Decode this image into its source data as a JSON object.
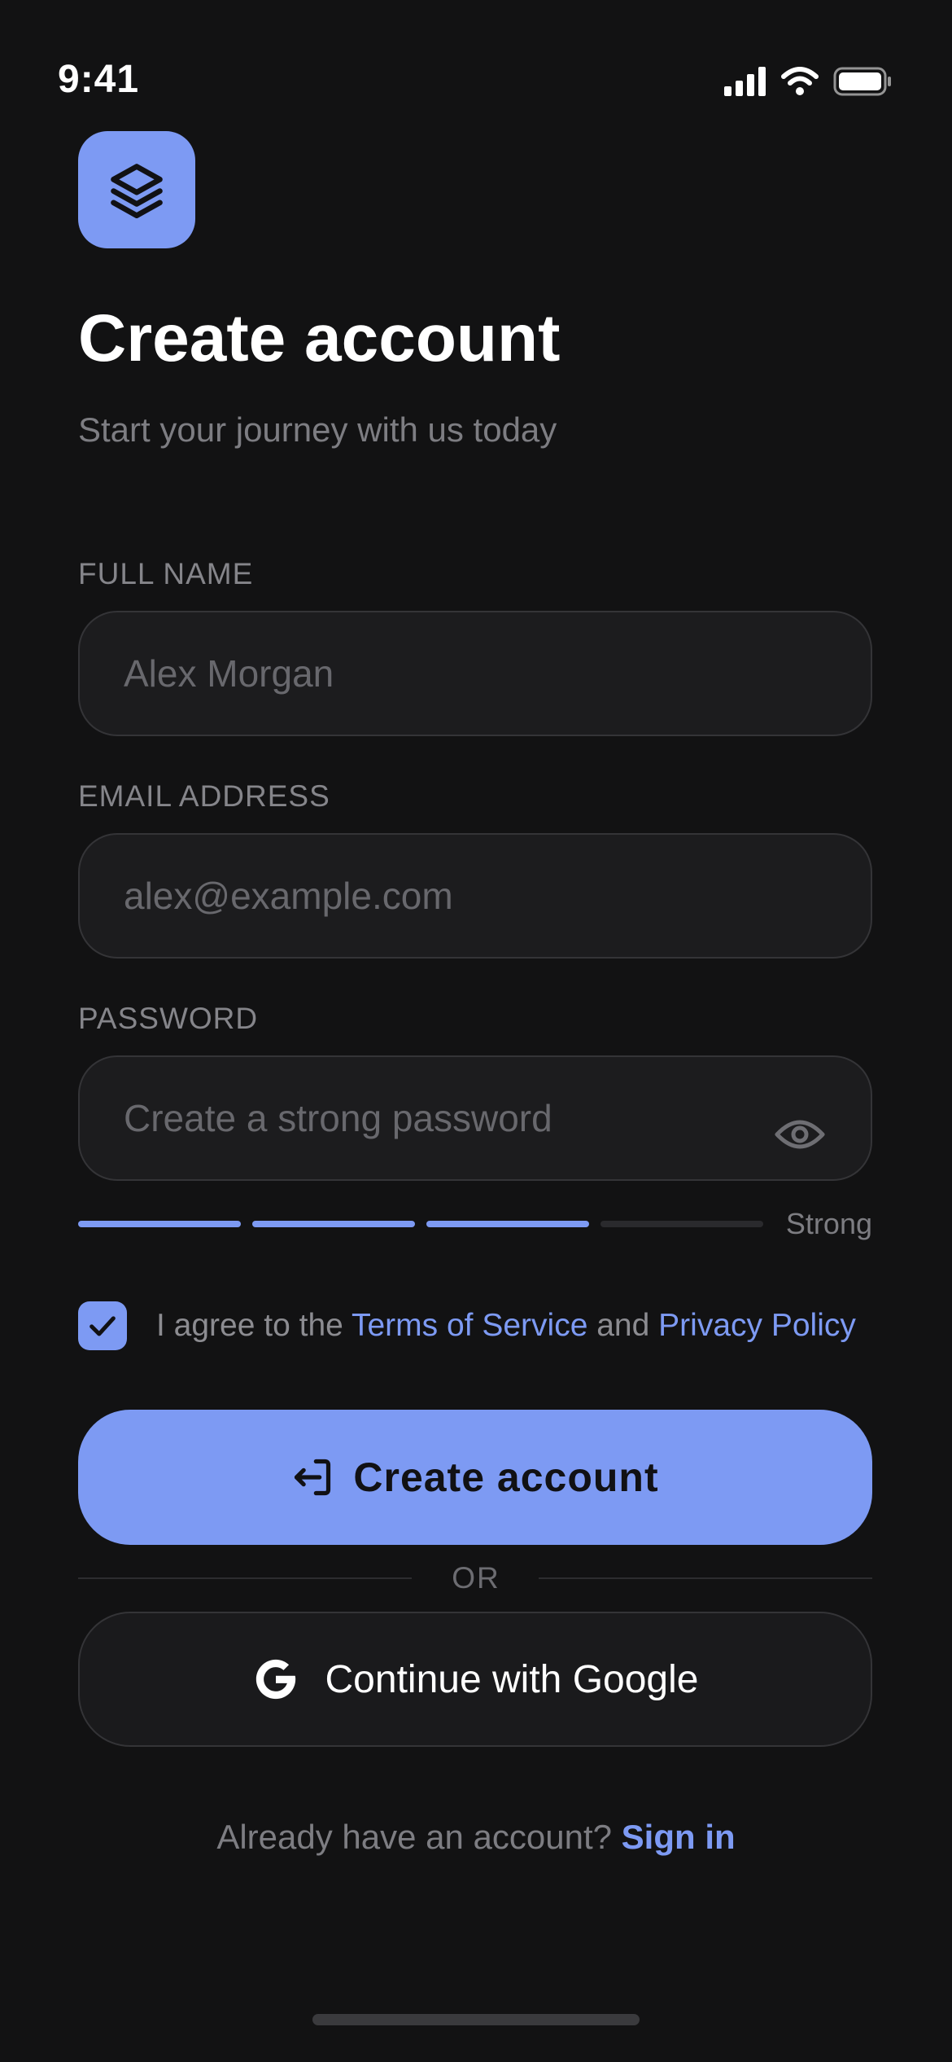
{
  "status_bar": {
    "time": "9:41",
    "icons": [
      "cellular-signal-icon",
      "wifi-icon",
      "battery-icon"
    ]
  },
  "header": {
    "logo_icon": "layers-stack-icon",
    "title": "Create account",
    "subtitle": "Start your journey with us today"
  },
  "form": {
    "full_name": {
      "label": "FULL NAME",
      "placeholder": "Alex Morgan",
      "value": ""
    },
    "email": {
      "label": "EMAIL ADDRESS",
      "placeholder": "alex@example.com",
      "value": ""
    },
    "password": {
      "label": "PASSWORD",
      "placeholder": "Create a strong password",
      "value": "",
      "toggle_icon": "eye-icon"
    },
    "strength": {
      "label": "Strong",
      "filled_segments": 3,
      "total_segments": 4
    },
    "agree": {
      "checked": true,
      "prefix": "I agree to the",
      "terms_link": "Terms of Service",
      "conjunction": "and",
      "privacy_link": "Privacy Policy"
    }
  },
  "actions": {
    "create_label": "Create account",
    "create_icon": "sign-in-icon",
    "divider_text": "OR",
    "google_label": "Continue with Google",
    "google_icon": "google-icon"
  },
  "footer": {
    "prompt": "Already have an account?",
    "signin_label": "Sign in"
  },
  "colors": {
    "background": "#121213",
    "accent": "#7d9af3",
    "field_background": "#1c1c1e",
    "muted_text": "#7d7d82"
  }
}
